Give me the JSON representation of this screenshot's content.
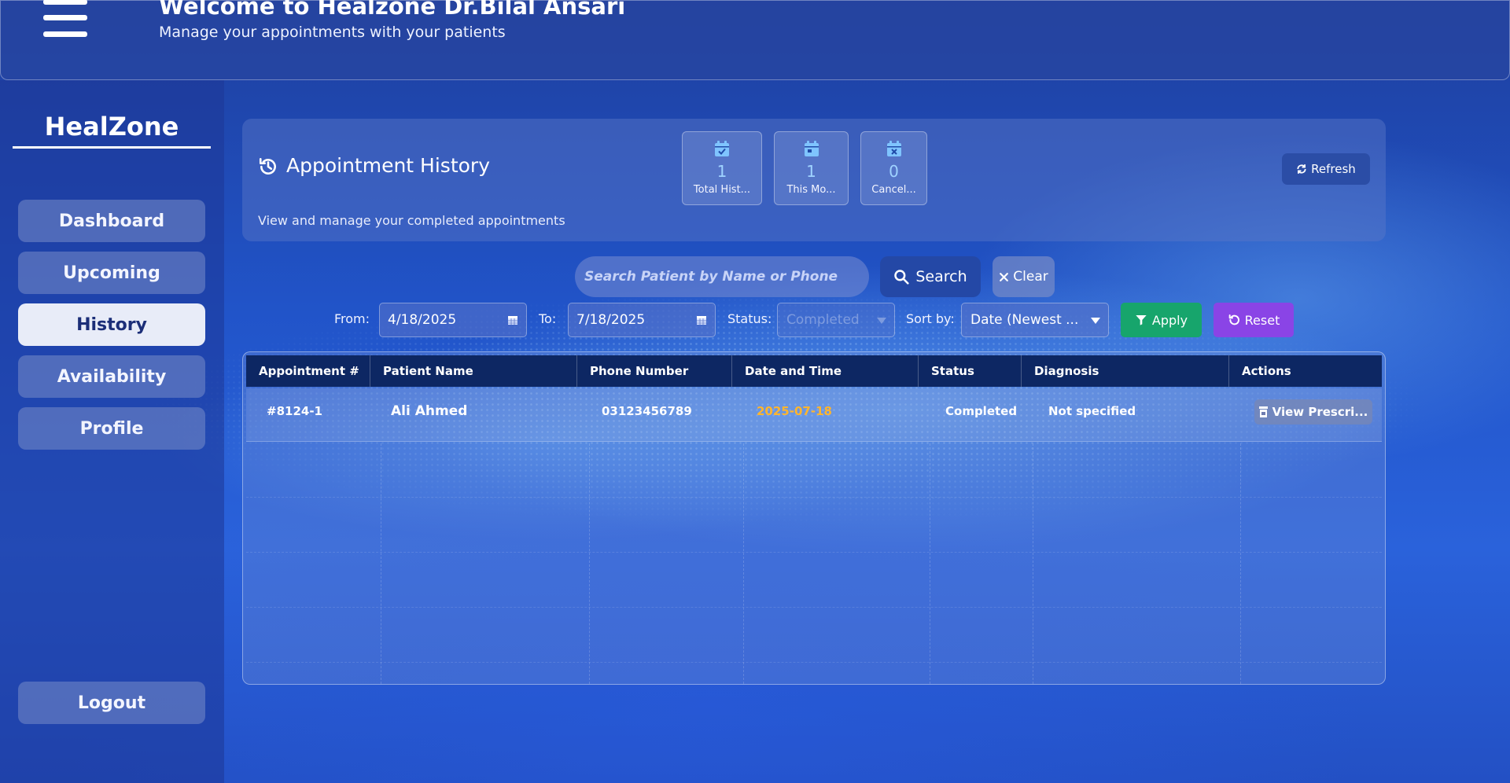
{
  "header": {
    "welcome": "Welcome to Healzone Dr.Bilal Ansari",
    "subtitle": "Manage your appointments with your patients"
  },
  "sidebar": {
    "brand": "HealZone",
    "items": [
      {
        "label": "Dashboard",
        "active": false
      },
      {
        "label": "Upcoming",
        "active": false
      },
      {
        "label": "History",
        "active": true
      },
      {
        "label": "Availability",
        "active": false
      },
      {
        "label": "Profile",
        "active": false
      }
    ],
    "logout": "Logout"
  },
  "history_card": {
    "title": "Appointment History",
    "description": "View and manage your completed appointments",
    "stats": [
      {
        "value": "1",
        "label": "Total Hist...",
        "icon": "calendar-check-icon"
      },
      {
        "value": "1",
        "label": "This Mo...",
        "icon": "calendar-icon"
      },
      {
        "value": "0",
        "label": "Cancel...",
        "icon": "calendar-x-icon"
      }
    ],
    "refresh_label": "Refresh"
  },
  "search": {
    "placeholder": "Search Patient by Name or Phone",
    "search_label": "Search",
    "clear_label": "Clear"
  },
  "filters": {
    "from_label": "From:",
    "from_value": "4/18/2025",
    "to_label": "To:",
    "to_value": "7/18/2025",
    "status_label": "Status:",
    "status_value": "Completed",
    "sort_label": "Sort by:",
    "sort_value": "Date (Newest ...",
    "apply_label": "Apply",
    "reset_label": "Reset"
  },
  "table": {
    "columns": [
      "Appointment #",
      "Patient Name",
      "Phone Number",
      "Date and Time",
      "Status",
      "Diagnosis",
      "Actions"
    ],
    "rows": [
      {
        "appointment": "#8124-1",
        "patient": "Ali Ahmed",
        "phone": "03123456789",
        "date": "2025-07-18",
        "status": "Completed",
        "diagnosis": "Not specified",
        "action": "View Prescri..."
      }
    ]
  },
  "colors": {
    "accent_date": "#ffb52e",
    "apply": "#17a56c",
    "reset": "#8a44e6",
    "table_header": "#0d2763"
  }
}
